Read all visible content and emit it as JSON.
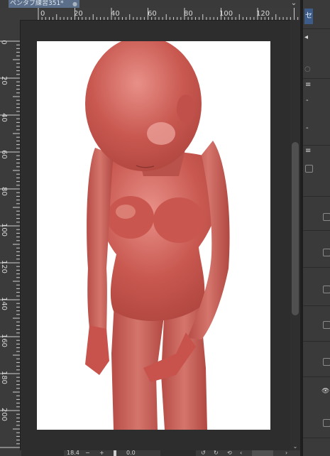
{
  "document_tab": {
    "title": "ペンタブ練習351*",
    "close_glyph": "●"
  },
  "tab_menu_glyph": "⌄",
  "ruler_top_labels": [
    "0",
    "20",
    "40",
    "60",
    "80",
    "100",
    "120"
  ],
  "ruler_left_labels": [
    "0",
    "20",
    "40",
    "60",
    "80",
    "100",
    "120",
    "140",
    "160",
    "180",
    "200"
  ],
  "status_bar": {
    "zoom_value": "18.4",
    "zoom_out": "−",
    "zoom_in": "+",
    "rotation_value": "0.0",
    "rotate_left": "↺",
    "rotate_right": "↻",
    "reset_rotation": "⟲",
    "prev": "‹",
    "next": "›"
  },
  "right_panel": {
    "header_label": "セ",
    "row1_glyph": "◂",
    "row2_glyph": "○",
    "row3_glyph": "≡",
    "label_a": "-",
    "label_b": "-",
    "eye_glyph": "👁"
  },
  "colors": {
    "figure": "#c85850",
    "accent_tab": "#5b6f8a"
  }
}
